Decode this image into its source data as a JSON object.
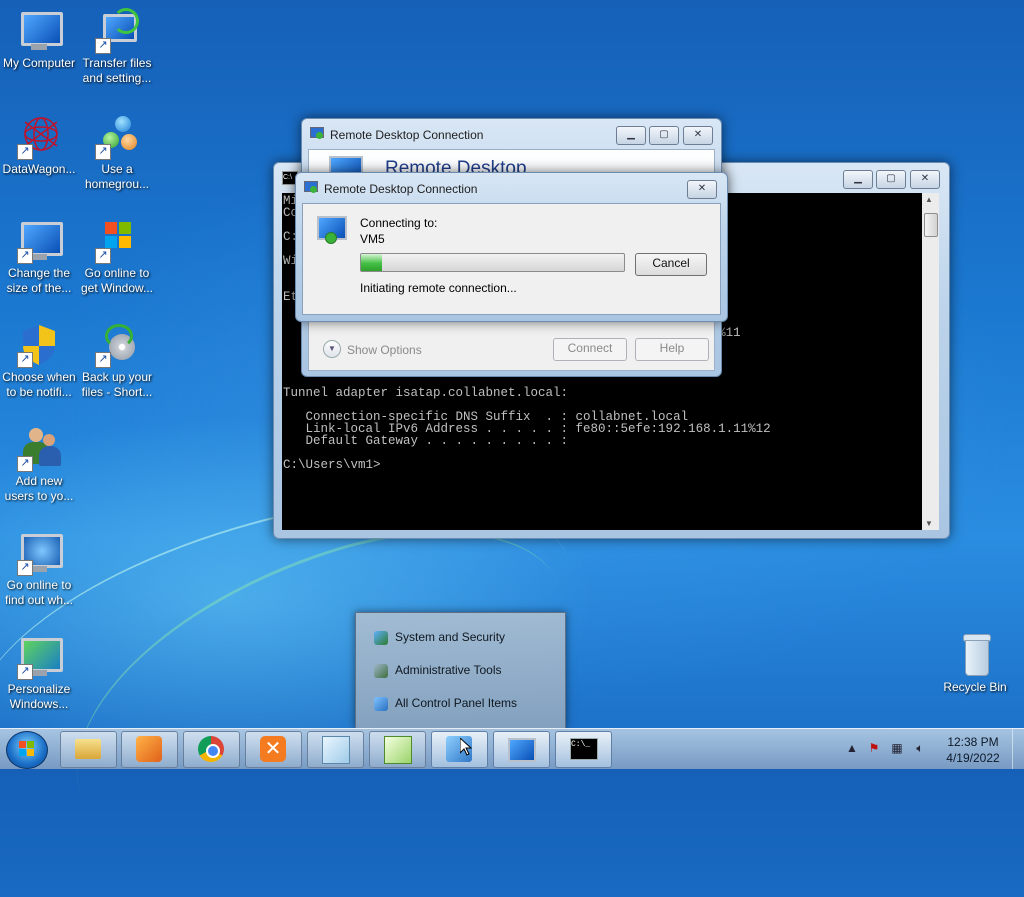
{
  "desktop": {
    "icons": [
      {
        "label": "My Computer"
      },
      {
        "label": "Transfer files and setting..."
      },
      {
        "label": "DataWagon..."
      },
      {
        "label": "Use a homegrou..."
      },
      {
        "label": "Change the size of the..."
      },
      {
        "label": "Go online to get Window..."
      },
      {
        "label": "Choose when to be notifi..."
      },
      {
        "label": "Back up your files - Short..."
      },
      {
        "label": "Add new users to yo..."
      },
      {
        "label": "Go online to find out wh..."
      },
      {
        "label": "Personalize Windows..."
      },
      {
        "label": "Recycle Bin"
      }
    ]
  },
  "cmd_window": {
    "lines": [
      "Mi",
      "Co                                                 served.",
      "",
      "C:",
      "",
      "Wi",
      "",
      "",
      "Et",
      "",
      "",
      "                                                 cc06:a5f5%11",
      "",
      "",
      "",
      "",
      "Tunnel adapter isatap.collabnet.local:",
      "",
      "   Connection-specific DNS Suffix  . : collabnet.local",
      "   Link-local IPv6 Address . . . . . : fe80::5efe:192.168.1.11%12",
      "   Default Gateway . . . . . . . . . :",
      "",
      "C:\\Users\\vm1>"
    ]
  },
  "rdc_main": {
    "title": "Remote Desktop Connection",
    "header": "Remote Desktop",
    "show_options": "Show Options",
    "connect": "Connect",
    "help": "Help"
  },
  "rdc_dialog": {
    "title": "Remote Desktop Connection",
    "connecting_to": "Connecting to:",
    "host": "VM5",
    "status": "Initiating remote connection...",
    "cancel": "Cancel",
    "progress_fraction": 0.08
  },
  "jumplist": {
    "items": [
      {
        "label": "System and Security"
      },
      {
        "label": "Administrative Tools"
      },
      {
        "label": "All Control Panel Items"
      }
    ]
  },
  "taskbar": {
    "time": "12:38 PM",
    "date": "4/19/2022"
  }
}
